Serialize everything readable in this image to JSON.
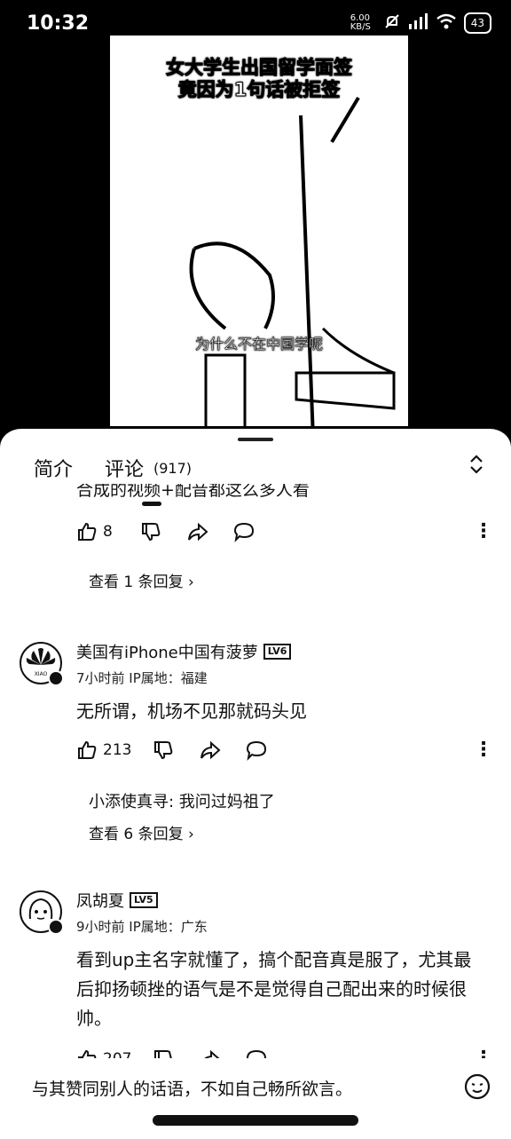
{
  "status": {
    "time": "10:32",
    "network_speed": "6.00 KB/S",
    "signal": "HD",
    "battery": "43"
  },
  "video": {
    "title_line1": "女大学生出国留学面签",
    "title_line2": "竟因为1句话被拒签",
    "subtitle": "为什么不在中国学呢"
  },
  "tabs": {
    "intro": "简介",
    "comments": "评论",
    "comments_count": "(917)"
  },
  "previous_comment": {
    "text": "合成的视频+配音都这么多人看",
    "likes": "8",
    "replies_link": "查看 1 条回复"
  },
  "comments": [
    {
      "username": "美国有iPhone中国有菠萝",
      "level": "LV6",
      "meta": "7小时前 IP属地：福建",
      "text": "无所谓，机场不见那就码头见",
      "likes": "213",
      "subreply": "小添使真寻: 我问过妈祖了",
      "replies_link": "查看 6 条回复"
    },
    {
      "username": "凤胡夏",
      "level": "LV5",
      "meta": "9小时前 IP属地：广东",
      "text": "看到up主名字就懂了，搞个配音真是服了，尤其最后抑扬顿挫的语气是不是觉得自己配出来的时候很帅。",
      "likes": "207"
    }
  ],
  "input": {
    "placeholder": "与其赞同别人的话语，不如自己畅所欲言。"
  }
}
